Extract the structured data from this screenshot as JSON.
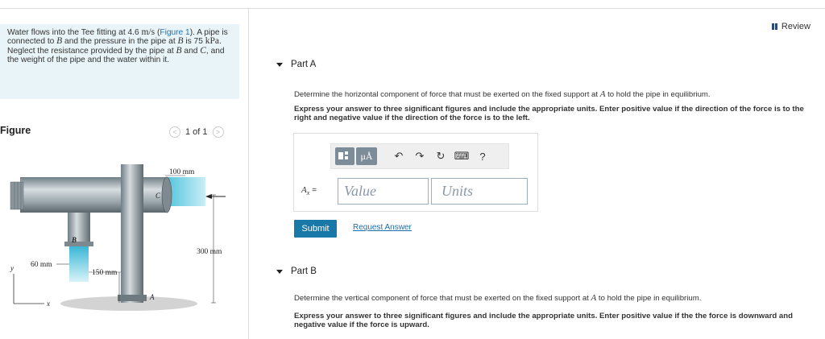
{
  "problem": {
    "t1": "Water flows into the Tee fitting at 4.6 ",
    "u1": "m/s",
    "t2": " (",
    "figure_link": "Figure 1",
    "t3": "). A pipe is connected to ",
    "b": "B",
    "t4": " and the pressure in the pipe at ",
    "b2": "B",
    "t5": " is 75 ",
    "u2": "kPa",
    "t6": ". Neglect the resistance provided by the pipe at ",
    "b3": "B",
    "t7": " and ",
    "c": "C",
    "t8": ", and the weight of the pipe and the water within it."
  },
  "figure": {
    "title": "Figure",
    "pager": "1 of 1",
    "prev_glyph": "<",
    "next_glyph": ">",
    "labels": {
      "dim_100": "100 mm",
      "dim_300": "300 mm",
      "dim_60": "60 mm",
      "dim_150": "150 mm",
      "pt_b": "B",
      "pt_c": "C",
      "pt_a": "A",
      "axis_y": "y",
      "axis_x": "x"
    }
  },
  "review": {
    "label": "Review"
  },
  "partA": {
    "label": "Part A",
    "q_pre": "Determine the horizontal component of force that must be exerted on the fixed support at ",
    "q_var": "A",
    "q_post": " to hold the pipe in equilibrium.",
    "instruction": "Express your answer to three significant figures and include the appropriate units. Enter positive value if the direction of the force is to the right and negative value if the direction of the force is to the left.",
    "var_label": "A",
    "var_sub": "x",
    "var_eq": " =",
    "value_placeholder": "Value",
    "units_placeholder": "Units",
    "toolbar": {
      "mu_label": "μÅ",
      "undo": "↶",
      "redo": "↷",
      "reset": "↻",
      "keyboard": "⌨",
      "help": "?"
    },
    "submit_label": "Submit",
    "request_label": "Request Answer"
  },
  "partB": {
    "label": "Part B",
    "q_pre": "Determine the vertical component of force that must be exerted on the fixed support at ",
    "q_var": "A",
    "q_post": " to hold the pipe in equilibrium.",
    "instruction": "Express your answer to three significant figures and include the appropriate units. Enter positive value if the the force is downward and negative value if the force is upward."
  }
}
